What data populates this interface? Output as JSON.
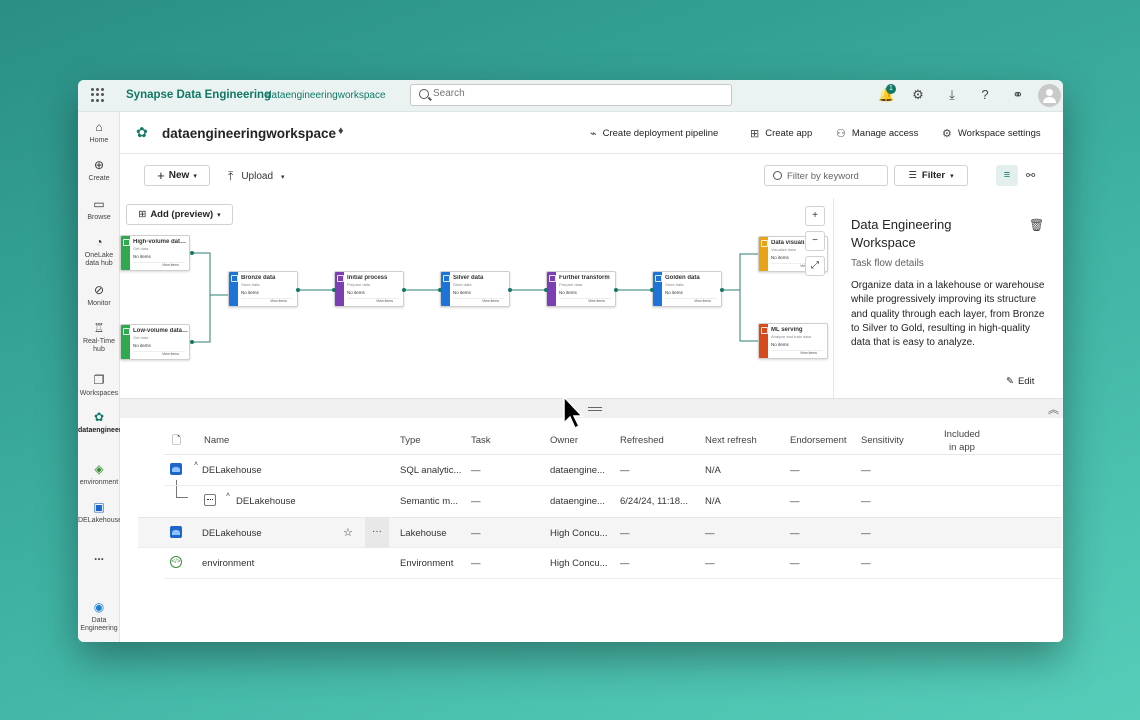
{
  "topbar": {
    "app_title": "Synapse Data Engineering",
    "workspace": "dataengineeringworkspace",
    "search_placeholder": "Search",
    "notification_count": "1",
    "icons": [
      "waffle-icon",
      "bell-icon",
      "gear-icon",
      "download-icon",
      "help-icon",
      "share-icon"
    ]
  },
  "rail": {
    "items": [
      {
        "label": "Home",
        "icon": "home-icon"
      },
      {
        "label": "Create",
        "icon": "plus-icon"
      },
      {
        "label": "Browse",
        "icon": "folder-icon"
      },
      {
        "label": "OneLake data hub",
        "icon": "onelake-icon"
      },
      {
        "label": "Monitor",
        "icon": "monitor-icon"
      },
      {
        "label": "Real-Time hub",
        "icon": "realtime-icon"
      },
      {
        "label": "Workspaces",
        "icon": "workspaces-icon"
      },
      {
        "label": "dataengineeringwor...",
        "icon": "workspace-icon"
      },
      {
        "label": "environment",
        "icon": "environment-icon"
      },
      {
        "label": "DELakehouse",
        "icon": "lakehouse-icon"
      },
      {
        "label": "...",
        "icon": "more-icon"
      },
      {
        "label": "Data Engineering",
        "icon": "data-engineering-icon"
      }
    ]
  },
  "header": {
    "workspace_name": "dataengineeringworkspace",
    "actions": [
      "Create deployment pipeline",
      "Create app",
      "Manage access",
      "Workspace settings"
    ]
  },
  "toolbar": {
    "new_label": "New",
    "upload_label": "Upload",
    "filter_placeholder": "Filter by keyword",
    "filter_label": "Filter"
  },
  "flow": {
    "add_label": "Add (preview)",
    "nodes": [
      {
        "title": "High-volume data ...",
        "subtitle": "Get data",
        "status": "No items",
        "view": "View items",
        "color": "#2fa84f"
      },
      {
        "title": "Low-volume data i...",
        "subtitle": "Get data",
        "status": "No items",
        "view": "View items",
        "color": "#2fa84f"
      },
      {
        "title": "Bronze data",
        "subtitle": "Store data",
        "status": "No items",
        "view": "View items",
        "color": "#1e73d8"
      },
      {
        "title": "Initial process",
        "subtitle": "Prepare data",
        "status": "No items",
        "view": "View items",
        "color": "#7a3fb3"
      },
      {
        "title": "Silver data",
        "subtitle": "Store data",
        "status": "No items",
        "view": "View items",
        "color": "#1e73d8"
      },
      {
        "title": "Further transform",
        "subtitle": "Prepare data",
        "status": "No items",
        "view": "View items",
        "color": "#7a3fb3"
      },
      {
        "title": "Golden data",
        "subtitle": "Store data",
        "status": "No items",
        "view": "View items",
        "color": "#1e73d8"
      },
      {
        "title": "Data visuali...",
        "subtitle": "Visualize data",
        "status": "No items",
        "view": "View items",
        "color": "#e8a317"
      },
      {
        "title": "ML serving",
        "subtitle": "Analyze and train data",
        "status": "No items",
        "view": "View items",
        "color": "#d84a1b"
      }
    ],
    "zoom_in": "+",
    "zoom_out": "−",
    "fit": "⤢"
  },
  "panel": {
    "title": "Data Engineering Workspace",
    "subtitle": "Task flow details",
    "description": "Organize data in a lakehouse or warehouse while progressively improving its structure and quality through each layer, from Bronze to Silver to Gold, resulting in high-quality data that is easy to analyze.",
    "edit_label": "Edit"
  },
  "table": {
    "columns": [
      "Name",
      "Type",
      "Task",
      "Owner",
      "Refreshed",
      "Next refresh",
      "Endorsement",
      "Sensitivity",
      "Included in app"
    ],
    "rows": [
      {
        "icon": "lake",
        "name": "DELakehouse",
        "type": "SQL analytic...",
        "task": "—",
        "owner": "dataengine...",
        "refreshed": "—",
        "next": "N/A",
        "endorsement": "—",
        "sensitivity": "—"
      },
      {
        "icon": "sem",
        "name": "DELakehouse",
        "type": "Semantic m...",
        "task": "—",
        "owner": "dataengine...",
        "refreshed": "6/24/24, 11:18...",
        "next": "N/A",
        "endorsement": "—",
        "sensitivity": "—"
      },
      {
        "icon": "lake",
        "name": "DELakehouse",
        "type": "Lakehouse",
        "task": "—",
        "owner": "High Concu...",
        "refreshed": "—",
        "next": "—",
        "endorsement": "—",
        "sensitivity": "—"
      },
      {
        "icon": "env",
        "name": "environment",
        "type": "Environment",
        "task": "—",
        "owner": "High Concu...",
        "refreshed": "—",
        "next": "—",
        "endorsement": "—",
        "sensitivity": "—"
      }
    ]
  }
}
